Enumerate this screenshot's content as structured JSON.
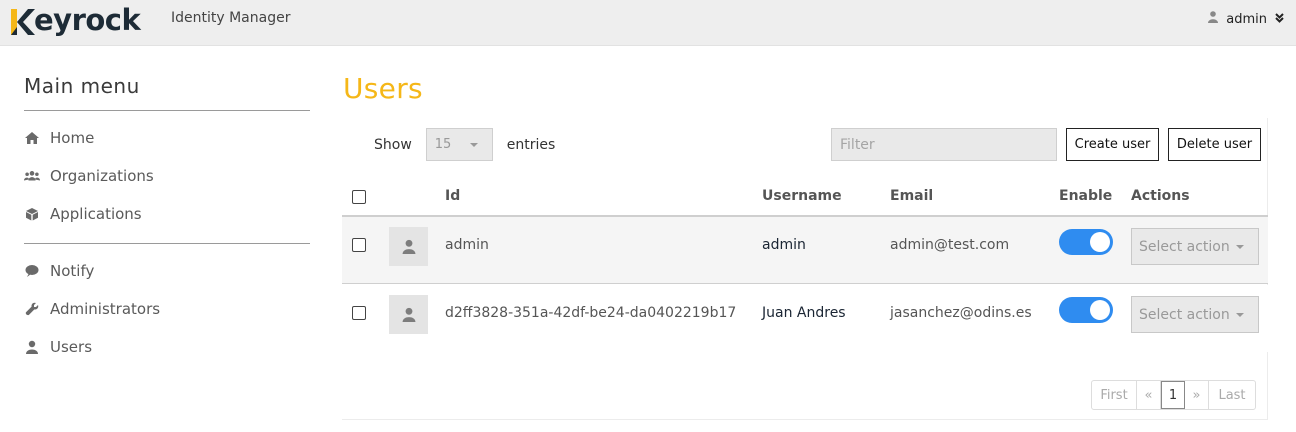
{
  "header": {
    "logo_text": "eyrock",
    "logo_initial": "K",
    "app_name": "Identity Manager",
    "user_label": "admin"
  },
  "sidebar": {
    "title": "Main menu",
    "groups": [
      [
        {
          "label": "Home",
          "icon": "home-icon"
        },
        {
          "label": "Organizations",
          "icon": "users-group-icon"
        },
        {
          "label": "Applications",
          "icon": "cube-icon"
        }
      ],
      [
        {
          "label": "Notify",
          "icon": "comment-icon"
        },
        {
          "label": "Administrators",
          "icon": "wrench-icon"
        },
        {
          "label": "Users",
          "icon": "user-icon"
        }
      ]
    ]
  },
  "main": {
    "title": "Users",
    "show_label": "Show",
    "entries_label": "entries",
    "page_length": "15",
    "filter_placeholder": "Filter",
    "create_button": "Create user",
    "delete_button": "Delete user"
  },
  "table": {
    "columns": [
      "Id",
      "Username",
      "Email",
      "Enable",
      "Actions"
    ],
    "rows": [
      {
        "id": "admin",
        "username": "admin",
        "email": "admin@test.com",
        "enabled": true,
        "action": "Select action"
      },
      {
        "id": "d2ff3828-351a-42df-be24-da0402219b17",
        "username": "Juan Andres",
        "email": "jasanchez@odins.es",
        "enabled": true,
        "action": "Select action"
      }
    ]
  },
  "pagination": {
    "first": "First",
    "prev": "«",
    "current": "1",
    "next": "»",
    "last": "Last"
  },
  "colors": {
    "accent": "#f5b718",
    "toggle_on": "#2f8cf0",
    "logo_dark": "#1d2b36"
  }
}
